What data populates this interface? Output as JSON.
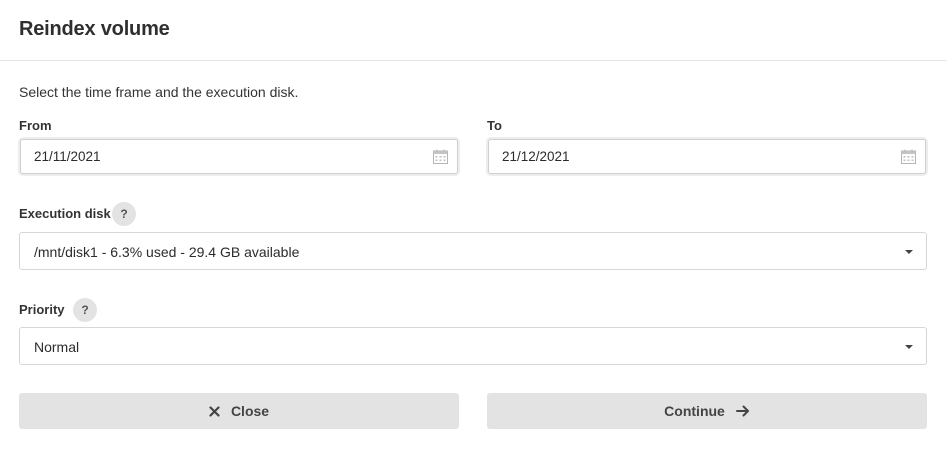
{
  "dialog": {
    "title": "Reindex volume",
    "intro": "Select the time frame and the execution disk."
  },
  "time_frame": {
    "from_label": "From",
    "from_value": "21/11/2021",
    "to_label": "To",
    "to_value": "21/12/2021"
  },
  "execution_disk": {
    "label": "Execution disk",
    "help": "?",
    "selected": "/mnt/disk1 - 6.3% used - 29.4 GB available"
  },
  "priority": {
    "label": "Priority",
    "help": "?",
    "selected": "Normal"
  },
  "actions": {
    "close_label": "Close",
    "continue_label": "Continue"
  },
  "icons": {
    "close": "close-icon",
    "continue": "arrow-right-icon",
    "calendar": "calendar-icon",
    "dropdown": "chevron-down-icon"
  }
}
